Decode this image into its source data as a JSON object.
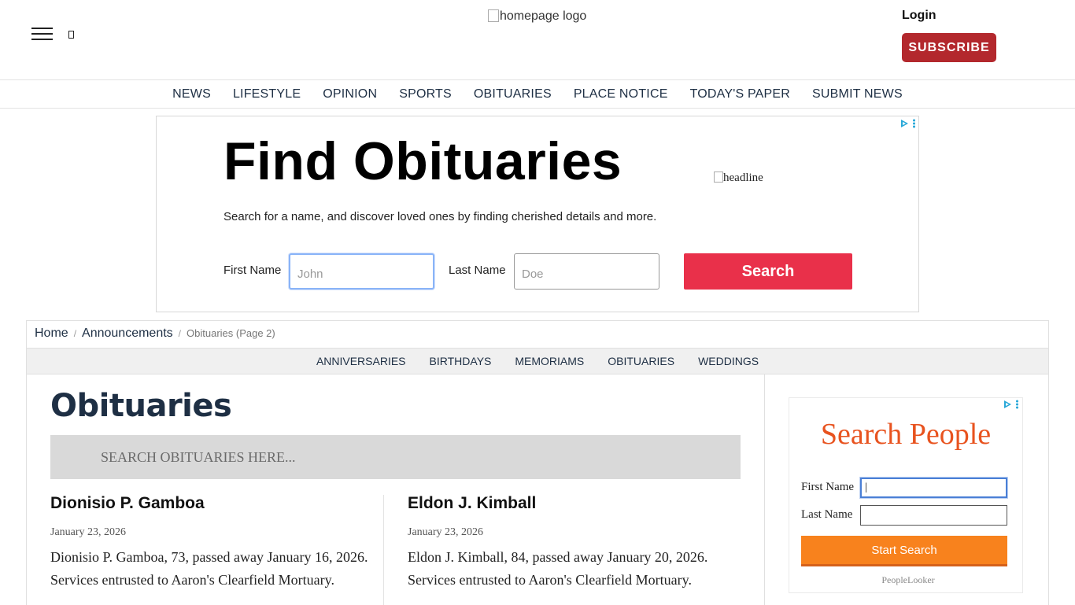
{
  "header": {
    "logo_alt": "homepage logo",
    "login_label": "Login",
    "subscribe_label": "SUBSCRIBE",
    "menu_icon": "hamburger-menu-icon",
    "search_icon": "search-icon",
    "search_glyph": "▯"
  },
  "main_nav": [
    "NEWS",
    "LIFESTYLE",
    "OPINION",
    "SPORTS",
    "OBITUARIES",
    "PLACE NOTICE",
    "TODAY'S PAPER",
    "SUBMIT NEWS"
  ],
  "ad_top": {
    "title": "Find Obituaries",
    "description": "Search for a name, and discover loved ones by finding cherished details and more.",
    "image_alt": "headline",
    "first_name_label": "First Name",
    "first_name_placeholder": "John",
    "last_name_label": "Last Name",
    "last_name_placeholder": "Doe",
    "search_button": "Search",
    "accent_color": "#e9304a"
  },
  "breadcrumb": {
    "home": "Home",
    "section": "Announcements",
    "current": "Obituaries (Page 2)",
    "separator": "/"
  },
  "sub_nav": [
    "ANNIVERSARIES",
    "BIRTHDAYS",
    "MEMORIAMS",
    "OBITUARIES",
    "WEDDINGS"
  ],
  "page": {
    "title": "Obituaries",
    "search_placeholder": "SEARCH OBITUARIES HERE..."
  },
  "obituaries": [
    {
      "name": "Dionisio P. Gamboa",
      "date": "January 23, 2026",
      "summary": "Dionisio P. Gamboa, 73, passed away January 16, 2026. Services entrusted to Aaron's Clearfield Mortuary."
    },
    {
      "name": "Eldon J. Kimball",
      "date": "January 23, 2026",
      "summary": "Eldon J. Kimball, 84, passed away January 20, 2026. Services entrusted to Aaron's Clearfield Mortuary."
    }
  ],
  "ad_side": {
    "title": "Search People",
    "first_name_label": "First Name",
    "first_name_value": "|",
    "last_name_label": "Last Name",
    "last_name_value": "",
    "button": "Start Search",
    "brand": "PeopleLooker",
    "title_color": "#e8531f",
    "button_color": "#f8821d"
  },
  "colors": {
    "subscribe": "#b3282d",
    "nav_text": "#1e2f44",
    "subnav_bg": "#f0f0f0"
  }
}
